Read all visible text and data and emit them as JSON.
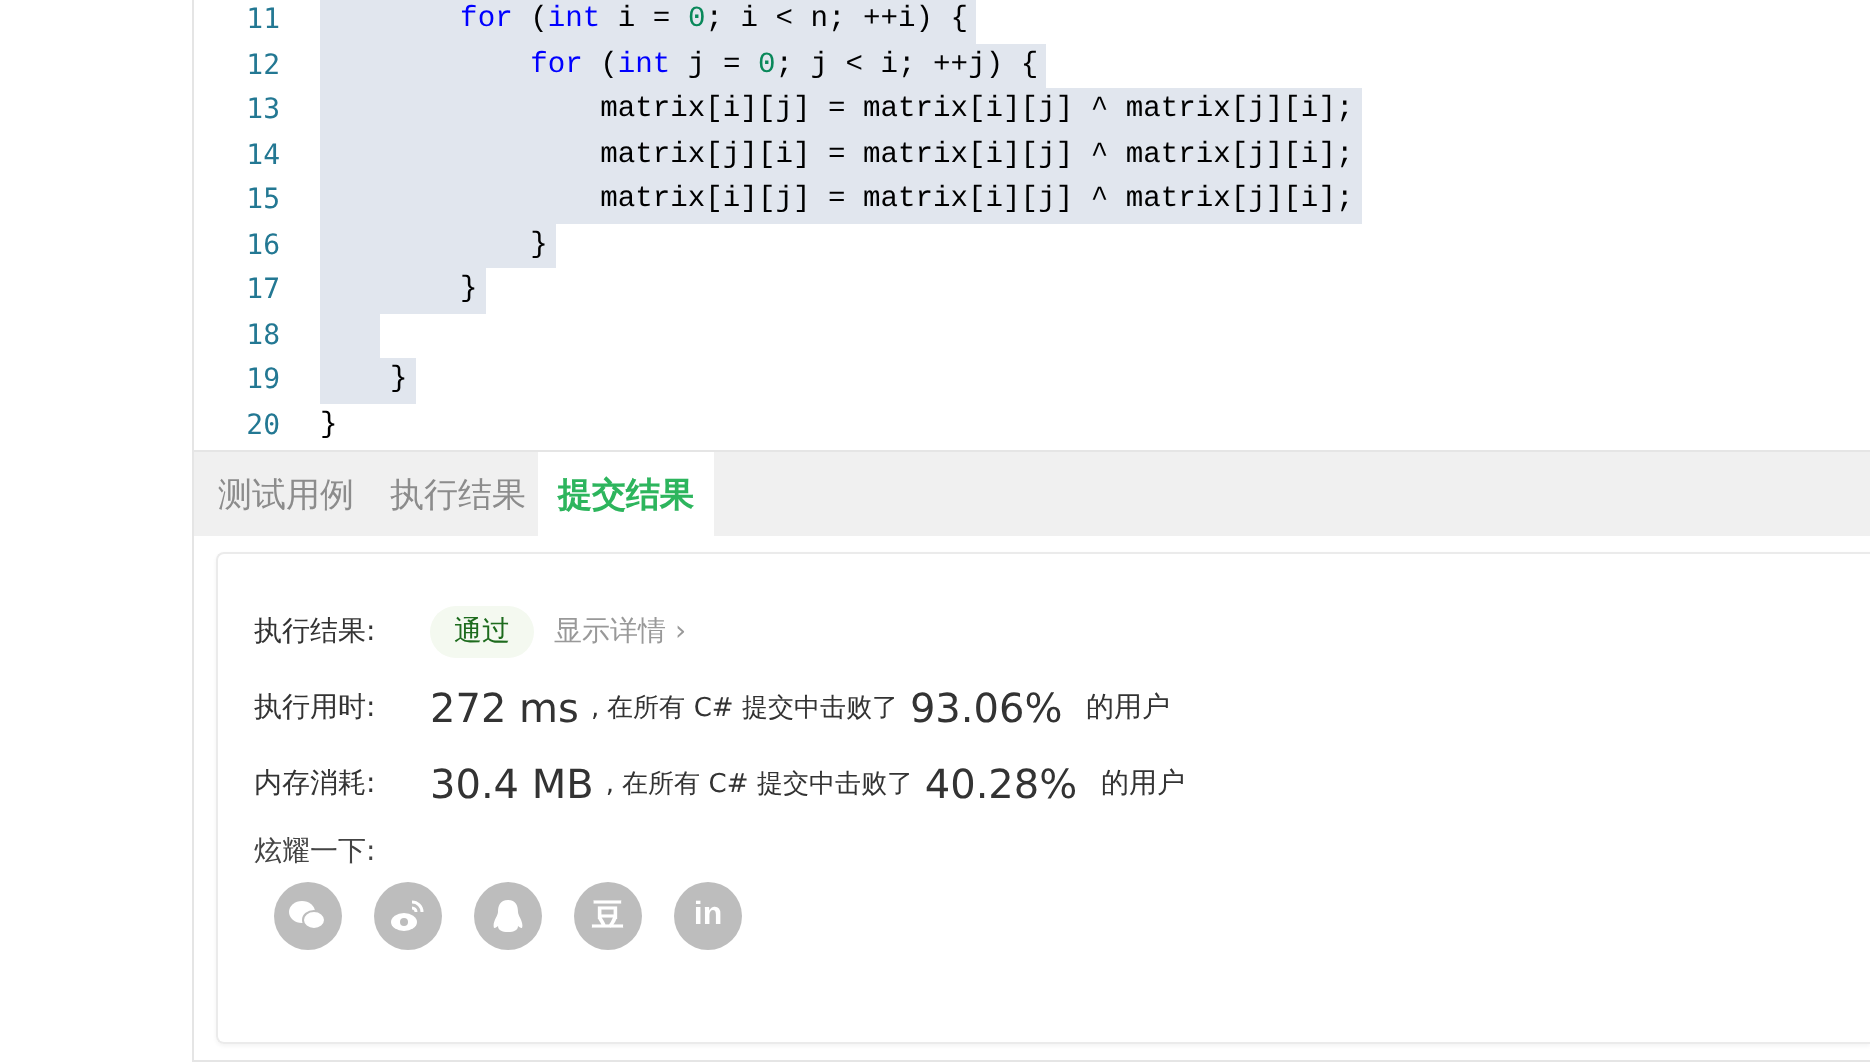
{
  "editor": {
    "lines": [
      {
        "number": "11",
        "selected": true,
        "tokens": [
          {
            "kind": "keyword",
            "text": "        for"
          },
          {
            "kind": "plain",
            "text": " ("
          },
          {
            "kind": "keyword",
            "text": "int"
          },
          {
            "kind": "plain",
            "text": " i = "
          },
          {
            "kind": "number",
            "text": "0"
          },
          {
            "kind": "plain",
            "text": "; i < n; ++i) {"
          }
        ]
      },
      {
        "number": "12",
        "selected": true,
        "tokens": [
          {
            "kind": "keyword",
            "text": "            for"
          },
          {
            "kind": "plain",
            "text": " ("
          },
          {
            "kind": "keyword",
            "text": "int"
          },
          {
            "kind": "plain",
            "text": " j = "
          },
          {
            "kind": "number",
            "text": "0"
          },
          {
            "kind": "plain",
            "text": "; j < i; ++j) {"
          }
        ]
      },
      {
        "number": "13",
        "selected": true,
        "tokens": [
          {
            "kind": "plain",
            "text": "                matrix[i][j] = matrix[i][j] ^ matrix[j][i];"
          }
        ]
      },
      {
        "number": "14",
        "selected": true,
        "tokens": [
          {
            "kind": "plain",
            "text": "                matrix[j][i] = matrix[i][j] ^ matrix[j][i];"
          }
        ]
      },
      {
        "number": "15",
        "selected": true,
        "tokens": [
          {
            "kind": "plain",
            "text": "                matrix[i][j] = matrix[i][j] ^ matrix[j][i];"
          }
        ]
      },
      {
        "number": "16",
        "selected": true,
        "tokens": [
          {
            "kind": "plain",
            "text": "            }"
          }
        ]
      },
      {
        "number": "17",
        "selected": true,
        "tokens": [
          {
            "kind": "plain",
            "text": "        }"
          }
        ]
      },
      {
        "number": "18",
        "selected": true
      },
      {
        "number": "19",
        "selected": true,
        "tokens": [
          {
            "kind": "plain",
            "text": "    }"
          }
        ]
      },
      {
        "number": "20",
        "selected": false,
        "tokens": [
          {
            "kind": "plain",
            "text": "}"
          }
        ]
      }
    ]
  },
  "tabs": [
    {
      "label": "测试用例",
      "selected": false
    },
    {
      "label": "执行结果",
      "selected": false
    },
    {
      "label": "提交结果",
      "selected": true
    }
  ],
  "result": {
    "status_label": "执行结果:",
    "status": "通过",
    "details_link": "显示详情",
    "details_caret": "›",
    "stats": [
      {
        "label": "执行用时:",
        "value": "272 ms",
        "middle": ", 在所有 C# 提交中击败了",
        "percent": "93.06%",
        "suffix": "的用户"
      },
      {
        "label": "内存消耗:",
        "value": "30.4 MB",
        "middle": ", 在所有 C# 提交中击败了",
        "percent": "40.28%",
        "suffix": "的用户"
      }
    ],
    "share_label": "炫耀一下:",
    "share_buttons": [
      {
        "kind": "wechat"
      },
      {
        "kind": "weibo"
      },
      {
        "kind": "qq"
      },
      {
        "kind": "glyph",
        "text": "豆"
      },
      {
        "kind": "glyph",
        "text": "in"
      }
    ]
  }
}
